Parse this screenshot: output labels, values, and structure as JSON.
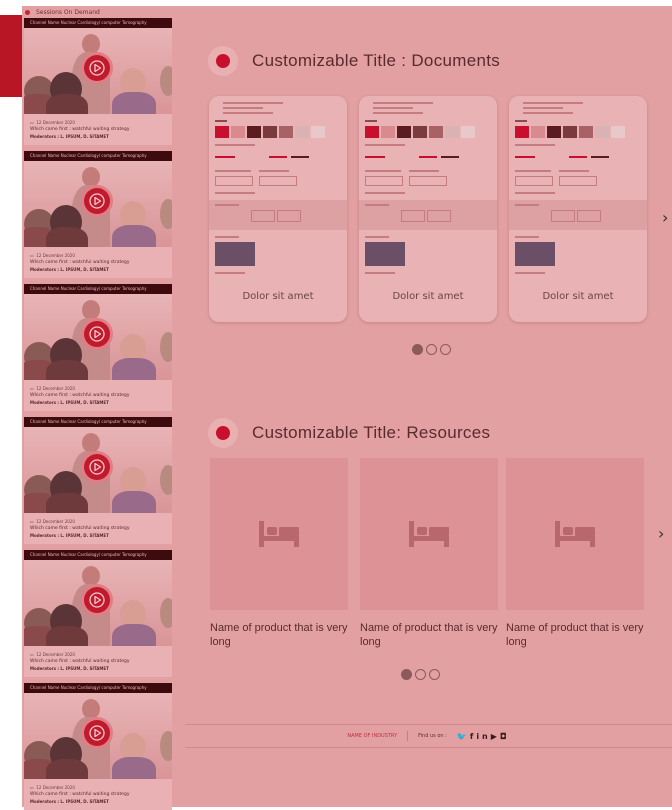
{
  "sidebar": {
    "heading": "Sessions On Demand",
    "cards": [
      {
        "channel": "Channel Name Nuclear Cardiology/ computer Tomography",
        "date": "12 December 2020",
        "title": "Which came first : watchful waiting strategy",
        "moderators": "Moderators : L. IPSUM, D. SITAMET"
      },
      {
        "channel": "Channel Name Nuclear Cardiology/ computer Tomography",
        "date": "12 December 2020",
        "title": "Which came first : watchful waiting strategy",
        "moderators": "Moderators : L. IPSUM, D. SITAMET"
      },
      {
        "channel": "Channel Name Nuclear Cardiology/ computer Tomography",
        "date": "12 December 2020",
        "title": "Which came first : watchful waiting strategy",
        "moderators": "Moderators : L. IPSUM, D. SITAMET"
      },
      {
        "channel": "Channel Name Nuclear Cardiology/ computer Tomography",
        "date": "12 December 2020",
        "title": "Which came first : watchful waiting strategy",
        "moderators": "Moderators : L. IPSUM, D. SITAMET"
      },
      {
        "channel": "Channel Name Nuclear Cardiology/ computer Tomography",
        "date": "12 December 2020",
        "title": "Which came first : watchful waiting strategy",
        "moderators": "Moderators : L. IPSUM, D. SITAMET"
      },
      {
        "channel": "Channel Name Nuclear Cardiology/ computer Tomography",
        "date": "12 December 2020",
        "title": "Which came first : watchful waiting strategy",
        "moderators": "Moderators : L. IPSUM, D. SITAMET"
      }
    ]
  },
  "documents": {
    "title": "Customizable Title : Documents",
    "items": [
      {
        "label": "Dolor sit amet"
      },
      {
        "label": "Dolor sit amet"
      },
      {
        "label": "Dolor sit amet"
      }
    ],
    "pagination": {
      "total": 3,
      "active": 1
    },
    "next_icon": "chevron-right-icon"
  },
  "resources": {
    "title": "Customizable Title: Resources",
    "items": [
      {
        "name": "Name of product that is very long",
        "icon": "bed-icon"
      },
      {
        "name": "Name of product that is very long",
        "icon": "bed-icon"
      },
      {
        "name": "Name of product that is very long",
        "icon": "bed-icon"
      }
    ],
    "pagination": {
      "total": 3,
      "active": 1
    },
    "next_icon": "chevron-right-icon"
  },
  "footer": {
    "industry": "NAME OF INDUSTRY",
    "find_us": "Find us on :",
    "social": [
      "twitter-icon",
      "facebook-icon",
      "linkedin-icon",
      "youtube-icon",
      "instagram-icon"
    ]
  },
  "colors": {
    "accent": "#c8102e",
    "overlay": "#e2a0a2",
    "dark_header": "#3d0b0d"
  }
}
